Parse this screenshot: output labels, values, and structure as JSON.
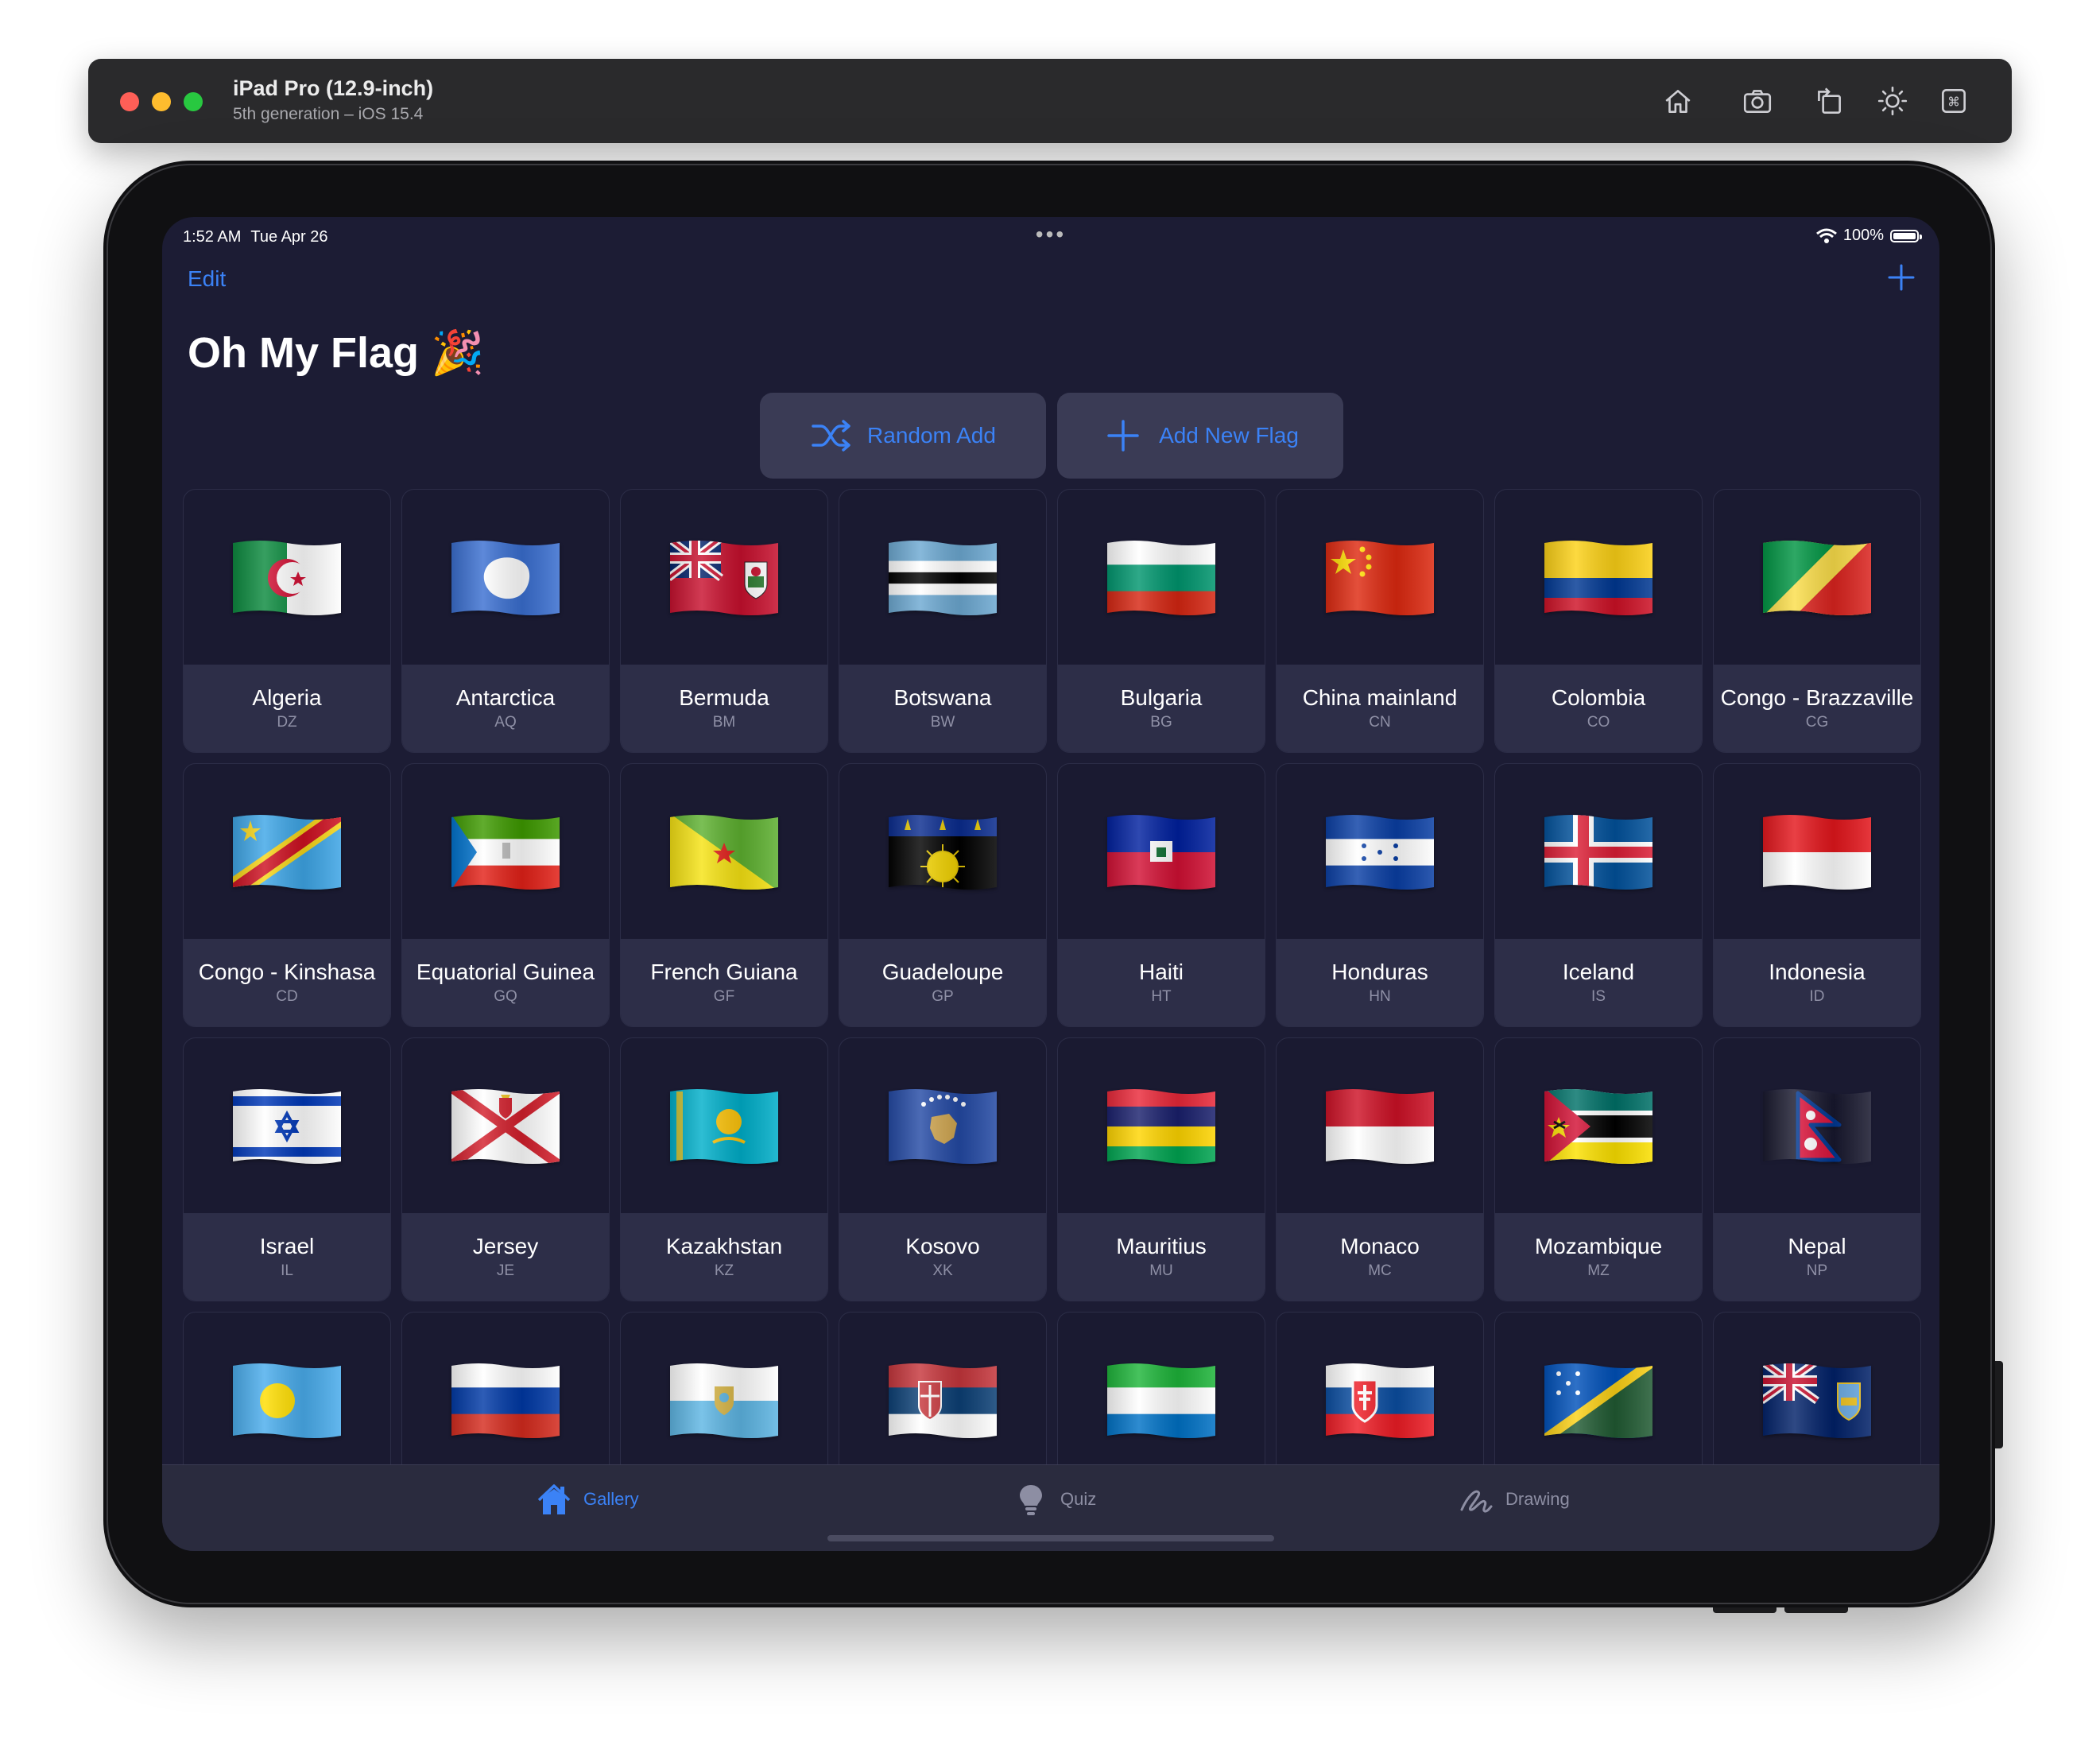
{
  "simulator": {
    "title": "iPad Pro (12.9-inch)",
    "subtitle": "5th generation – iOS 15.4",
    "traffic_colors": [
      "#fe5f57",
      "#febc2e",
      "#28c840"
    ],
    "tools": [
      "home-icon",
      "screenshot-icon",
      "rotate-icon",
      "appearance-icon",
      "keyboard-shortcut-icon"
    ]
  },
  "status_bar": {
    "time": "1:52 AM",
    "date": "Tue Apr 26",
    "battery": "100%"
  },
  "nav": {
    "edit_label": "Edit",
    "title": "Oh My Flag 🎉"
  },
  "actions": {
    "random_label": "Random Add",
    "add_label": "Add New Flag"
  },
  "accent_color": "#3b82f6",
  "flags": [
    {
      "name": "Algeria",
      "code": "DZ"
    },
    {
      "name": "Antarctica",
      "code": "AQ"
    },
    {
      "name": "Bermuda",
      "code": "BM"
    },
    {
      "name": "Botswana",
      "code": "BW"
    },
    {
      "name": "Bulgaria",
      "code": "BG"
    },
    {
      "name": "China mainland",
      "code": "CN"
    },
    {
      "name": "Colombia",
      "code": "CO"
    },
    {
      "name": "Congo - Brazzaville",
      "code": "CG"
    },
    {
      "name": "Congo - Kinshasa",
      "code": "CD"
    },
    {
      "name": "Equatorial Guinea",
      "code": "GQ"
    },
    {
      "name": "French Guiana",
      "code": "GF"
    },
    {
      "name": "Guadeloupe",
      "code": "GP"
    },
    {
      "name": "Haiti",
      "code": "HT"
    },
    {
      "name": "Honduras",
      "code": "HN"
    },
    {
      "name": "Iceland",
      "code": "IS"
    },
    {
      "name": "Indonesia",
      "code": "ID"
    },
    {
      "name": "Israel",
      "code": "IL"
    },
    {
      "name": "Jersey",
      "code": "JE"
    },
    {
      "name": "Kazakhstan",
      "code": "KZ"
    },
    {
      "name": "Kosovo",
      "code": "XK"
    },
    {
      "name": "Mauritius",
      "code": "MU"
    },
    {
      "name": "Monaco",
      "code": "MC"
    },
    {
      "name": "Mozambique",
      "code": "MZ"
    },
    {
      "name": "Nepal",
      "code": "NP"
    }
  ],
  "partial_row_flags": [
    "palau-flag-icon",
    "russia-flag-icon",
    "san-marino-flag-icon",
    "serbia-flag-icon",
    "sierra-leone-flag-icon",
    "slovakia-flag-icon",
    "solomon-islands-flag-icon",
    "st-helena-flag-icon"
  ],
  "tabs": [
    {
      "label": "Gallery",
      "icon": "house-icon",
      "selected": true
    },
    {
      "label": "Quiz",
      "icon": "lightbulb-icon",
      "selected": false
    },
    {
      "label": "Drawing",
      "icon": "scribble-icon",
      "selected": false
    }
  ]
}
